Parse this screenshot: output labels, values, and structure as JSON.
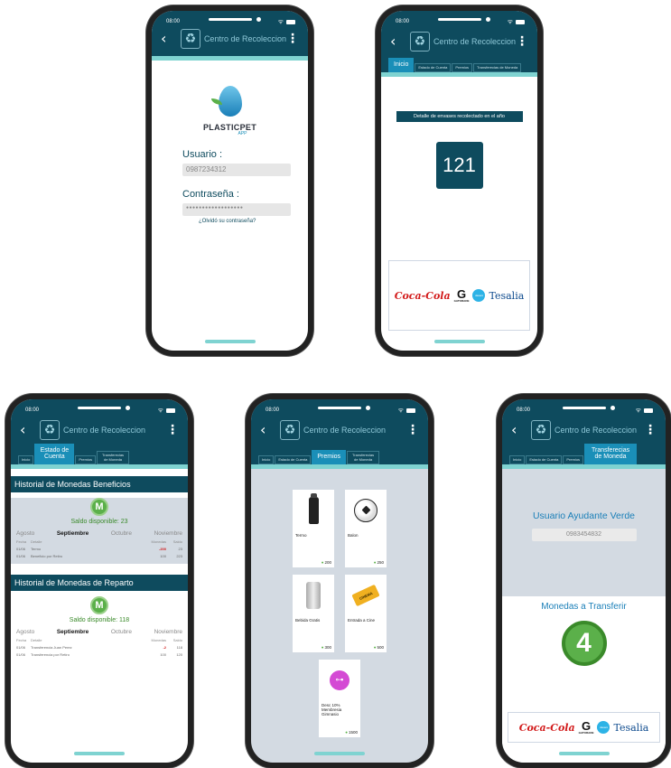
{
  "app": {
    "status_time": "08:00",
    "nav_title": "Centro de Recoleccion",
    "back_symbol": "‹",
    "kebab_symbol": "⋮",
    "recycle_symbol": "♻"
  },
  "brand": {
    "name": "PLASTICPET",
    "suffix": "APP"
  },
  "login": {
    "user_label": "Usuario :",
    "user_value": "0987234312",
    "pass_label": "Contraseña :",
    "pass_value": "●●●●●●●●●●●●●●●●●●",
    "forgot": "¿Olvidó su contraseña?"
  },
  "tabs_home": [
    "Inicio",
    "Estado de Cuenta",
    "Premios",
    "Transferecias de Moneda"
  ],
  "home": {
    "detail_label": "Detalle de envases recolectado en el año",
    "count": "121"
  },
  "sponsors": {
    "coca": "Coca-Cola",
    "gatorade_g": "G",
    "gatorade": "GATORADE",
    "dasani": "dasani",
    "tesalia": "Tesalia"
  },
  "account": {
    "tabs": [
      "Inicio",
      "Estado de Cuenta",
      "Premios",
      "Transferecias de Moneda"
    ],
    "coin_letter": "M",
    "benefits": {
      "title": "Historial de Monedas Beneficios",
      "saldo": "Saldo disponible:  23",
      "months": [
        "Agosto",
        "Septiembre",
        "Octubre",
        "Noviembre"
      ],
      "headers": [
        "Fecha",
        "Detalle",
        "Monedas",
        "Saldo"
      ],
      "rows": [
        {
          "fecha": "01/06",
          "detalle": "Termo",
          "monedas": "-200",
          "saldo": "23"
        },
        {
          "fecha": "01/06",
          "detalle": "Beneficio por Retiro",
          "monedas": "100",
          "saldo": "223"
        }
      ]
    },
    "delivery": {
      "title": "Historial de Monedas de Reparto",
      "saldo": "Saldo disponible:  118",
      "months": [
        "Agosto",
        "Septiembre",
        "Octubre",
        "Noviembre"
      ],
      "headers": [
        "Fecha",
        "Detalle",
        "Monedas",
        "Saldo"
      ],
      "rows": [
        {
          "fecha": "01/06",
          "detalle": "Transferencia Juan Perez",
          "monedas": "-2",
          "saldo": "118"
        },
        {
          "fecha": "01/06",
          "detalle": "Transferencia por Retiro",
          "monedas": "100",
          "saldo": "120"
        }
      ]
    }
  },
  "prizes": {
    "tabs": [
      "Inicio",
      "Estado de Cuenta",
      "Premios",
      "Transferecias de Moneda"
    ],
    "items": [
      {
        "name": "Termo",
        "cost": "200"
      },
      {
        "name": "Balon",
        "cost": "250"
      },
      {
        "name": "Bebida Gratis",
        "cost": "300"
      },
      {
        "name": "Entrada a Cine",
        "cost": "500"
      },
      {
        "name": "Desc 10% Membresia Gimnasio",
        "cost": "1500"
      }
    ],
    "cinema_label": "CINEMA"
  },
  "transfer": {
    "tabs": [
      "Inicio",
      "Estado de Cuenta",
      "Premios",
      "Transferecias de Moneda"
    ],
    "user_title": "Usuario Ayudante Verde",
    "user_id": "0983454832",
    "coins_title": "Monedas a Transferir",
    "coins_value": "4"
  }
}
